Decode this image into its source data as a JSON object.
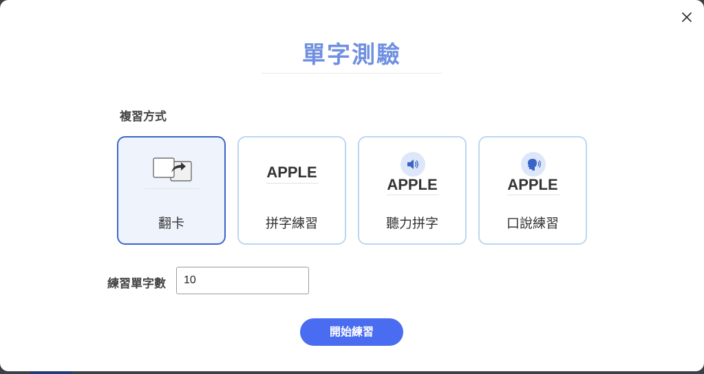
{
  "modal": {
    "title": "單字測驗",
    "close_icon": "close-icon"
  },
  "review_mode": {
    "label": "複習方式",
    "options": [
      {
        "label": "翻卡",
        "icon": "flip-card-icon",
        "selected": true
      },
      {
        "label": "拼字練習",
        "preview_word": "APPLE",
        "selected": false
      },
      {
        "label": "聽力拼字",
        "preview_word": "APPLE",
        "icon": "speaker-icon",
        "selected": false
      },
      {
        "label": "口說練習",
        "preview_word": "APPLE",
        "icon": "speaking-head-icon",
        "selected": false
      }
    ]
  },
  "word_count": {
    "label": "練習單字數",
    "value": "10"
  },
  "start_button": {
    "label": "開始練習"
  },
  "colors": {
    "title": "#6f8fe0",
    "accent": "#4a6cf0",
    "selected_border": "#3a64c8",
    "card_border": "#bcd6f2"
  }
}
